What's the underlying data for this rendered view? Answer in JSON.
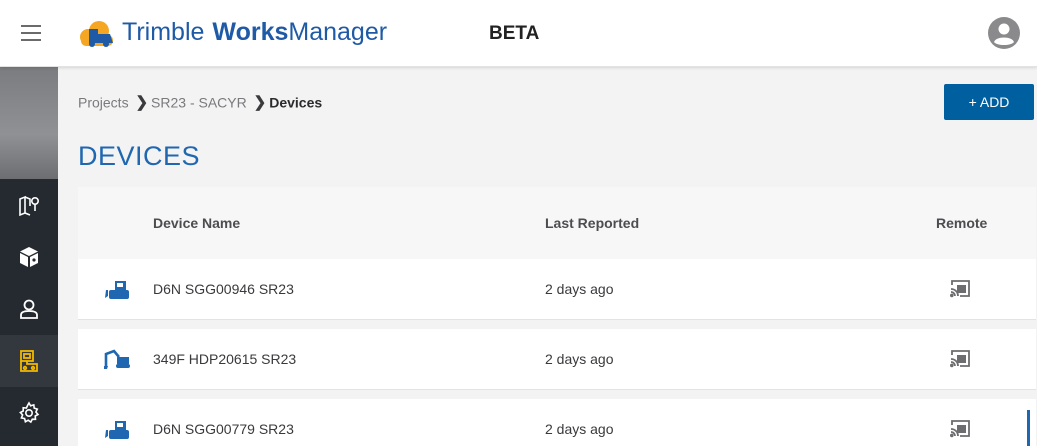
{
  "header": {
    "brand_part1": "Trimble",
    "brand_part2": "Works",
    "brand_part3": "Manager",
    "beta": "BETA"
  },
  "sidebar": {
    "items": [
      {
        "icon": "map-icon",
        "label": "Map"
      },
      {
        "icon": "cube-icon",
        "label": "Design"
      },
      {
        "icon": "user-icon",
        "label": "Users"
      },
      {
        "icon": "device-icon",
        "label": "Devices"
      },
      {
        "icon": "gear-icon",
        "label": "Settings"
      }
    ]
  },
  "breadcrumb": {
    "projects": "Projects",
    "project": "SR23 - SACYR",
    "current": "Devices",
    "sep": "❯"
  },
  "add_button": {
    "label": "+ ADD"
  },
  "page_title": "DEVICES",
  "table": {
    "columns": [
      "Device Name",
      "Last Reported",
      "Remote"
    ],
    "rows": [
      {
        "icon": "dozer-icon",
        "name": "D6N SGG00946 SR23",
        "last_reported": "2 days ago"
      },
      {
        "icon": "excavator-icon",
        "name": "349F HDP20615 SR23",
        "last_reported": "2 days ago"
      },
      {
        "icon": "dozer-icon",
        "name": "D6N SGG00779 SR23",
        "last_reported": "2 days ago"
      }
    ]
  },
  "colors": {
    "brand": "#1f5aa6",
    "accent": "#005f9e",
    "sidebar": "#252a31",
    "active_icon": "#f2b800"
  }
}
